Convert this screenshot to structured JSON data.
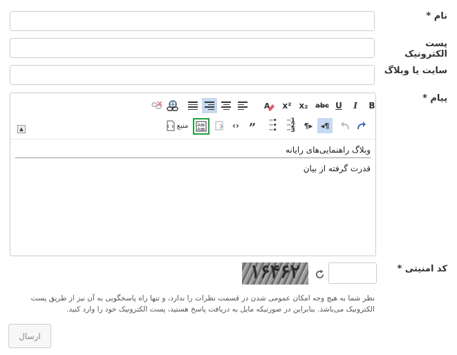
{
  "form": {
    "name_label": "نام *",
    "email_label": "پست الکترونیک",
    "website_label": "سایت یا وبلاگ",
    "message_label": "پیام *",
    "captcha_label": "کد امنیتی *",
    "name_value": "",
    "email_value": "",
    "website_value": "",
    "captcha_value": "",
    "note_line1": "نظر شما به هیچ وجه امکان عمومی شدن در قسمت نظرات را ندارد، و تنها راه پاسخگویی به آن نیز از طریق پست",
    "note_line2": "الکترونیک می‌باشد. بنابراین در صورتیکه مایل به دریافت پاسخ هستید، پست الکترونیک خود را وارد کنید.",
    "submit_label": "ارسال"
  },
  "editor": {
    "toolbar": {
      "bold": "B",
      "italic": "I",
      "underline": "U",
      "strike": "abc",
      "subscript": "x₂",
      "superscript": "x²",
      "source": "منبع"
    },
    "content": {
      "line1": "وبلاگ راهنمایی‌های رایانه",
      "line2": "قدرت گرفته از بیان"
    }
  },
  "captcha": {
    "image_text": "۱۶۴۶۲"
  },
  "colors": {
    "active_button": "#c5d9f1",
    "highlight_border": "#1e9e42"
  }
}
